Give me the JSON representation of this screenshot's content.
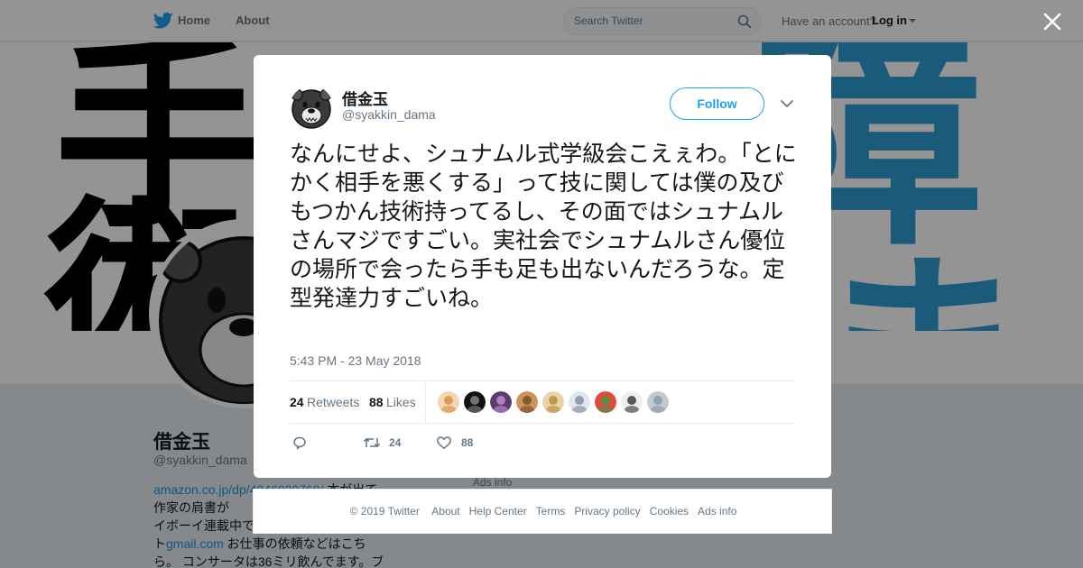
{
  "nav": {
    "home_label": "Home",
    "about_label": "About",
    "search_placeholder": "Search Twitter",
    "have_account_text": "Have an account?",
    "login_label": "Log in"
  },
  "banner": {
    "left_chars_top": "手",
    "left_chars_bottom": "術",
    "right_chars_top": "障",
    "right_chars_bottom": "ま"
  },
  "profile": {
    "name": "借金玉",
    "handle": "@syakkin_dama",
    "bio_link": "amazon.co.jp/dp/4046020768/",
    "bio_text_1": " 本が出て、作家の肩書が",
    "bio_text_2": "イボーイ連載中で",
    "bio_text_3": "ト",
    "bio_email_link": "gmail.com",
    "bio_text_4": " お仕事の依頼などはこちら。 コンサータは36ミリ飲んでます。ブ",
    "ads_info": "Ads info"
  },
  "tweet": {
    "author_name": "借金玉",
    "author_handle": "@syakkin_dama",
    "follow_label": "Follow",
    "text": "なんにせよ、シュナムル式学級会こえぇわ。「とにかく相手を悪くする」って技に関しては僕の及びもつかん技術持ってるし、その面ではシュナムルさんマジですごい。実社会でシュナムルさん優位の場所で会ったら手も足も出ないんだろうな。定型発達力すごいね。",
    "timestamp": "5:43 PM - 23 May 2018",
    "retweets_count": "24",
    "retweets_label": "Retweets",
    "likes_count": "88",
    "likes_label": "Likes",
    "action_retweet_count": "24",
    "action_like_count": "88",
    "likers": [
      {
        "color": "#f3d7b0",
        "accent": "#d98a4a"
      },
      {
        "color": "#111111",
        "accent": "#888888"
      },
      {
        "color": "#5b3a6e",
        "accent": "#c78fd8"
      },
      {
        "color": "#c9955a",
        "accent": "#7a4a22"
      },
      {
        "color": "#e8d3a6",
        "accent": "#b58b3c"
      },
      {
        "color": "#dfe6ee",
        "accent": "#7f8a99"
      },
      {
        "color": "#e24b3b",
        "accent": "#3a9d4c"
      },
      {
        "color": "#eeeeee",
        "accent": "#333333"
      },
      {
        "color": "#c1c9d2",
        "accent": "#8a96a3"
      }
    ]
  },
  "footer": {
    "copyright": "© 2019 Twitter",
    "links": [
      "About",
      "Help Center",
      "Terms",
      "Privacy policy",
      "Cookies",
      "Ads info"
    ]
  },
  "colors": {
    "twitter_blue": "#1da1f2",
    "link_blue": "#1b95e0",
    "banner_blue": "#2d9bd4"
  }
}
